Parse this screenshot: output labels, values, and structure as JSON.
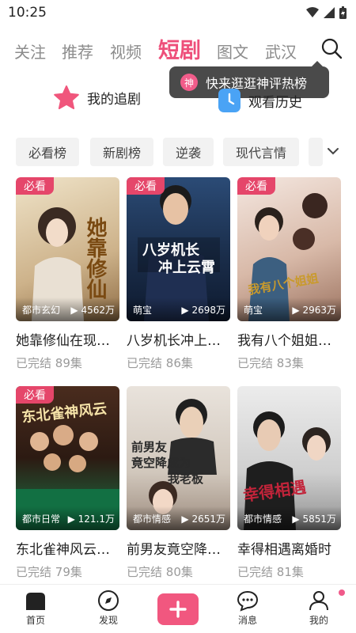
{
  "status": {
    "time": "10:25"
  },
  "nav": {
    "tabs": [
      "关注",
      "推荐",
      "视频",
      "短剧",
      "图文",
      "武汉"
    ],
    "active": "短剧"
  },
  "tooltip": {
    "badge": "神",
    "text": "快来逛逛神评热榜"
  },
  "quick": {
    "follow": "我的追剧",
    "history": "观看历史"
  },
  "chips": [
    "必看榜",
    "新剧榜",
    "逆袭",
    "现代言情"
  ],
  "cards": [
    {
      "badge": "必看",
      "genre": "都市玄幻",
      "views": "▶ 4562万",
      "title": "她靠修仙在现…",
      "status": "已完结",
      "episodes": "89集",
      "poster_text": "她靠修仙"
    },
    {
      "badge": "必看",
      "genre": "萌宝",
      "views": "▶ 2698万",
      "title": "八岁机长冲上…",
      "status": "已完结",
      "episodes": "86集",
      "poster_text": "八岁机长冲上云霄"
    },
    {
      "badge": "必看",
      "genre": "萌宝",
      "views": "▶ 2963万",
      "title": "我有八个姐姐…",
      "status": "已完结",
      "episodes": "83集",
      "poster_text": "我有八个姐姐"
    },
    {
      "badge": "必看",
      "genre": "都市日常",
      "views": "▶ 121.1万",
      "title": "东北雀神风云…",
      "status": "已完结",
      "episodes": "79集",
      "poster_text": "东北雀神风云"
    },
    {
      "badge": "",
      "genre": "都市情感",
      "views": "▶ 2651万",
      "title": "前男友竟空降…",
      "status": "已完结",
      "episodes": "80集",
      "poster_text": "前男友竟空降成为我老板"
    },
    {
      "badge": "",
      "genre": "都市情感",
      "views": "▶ 5851万",
      "title": "幸得相遇离婚时",
      "status": "已完结",
      "episodes": "81集",
      "poster_text": "幸得相遇"
    }
  ],
  "bottom": {
    "home": "首页",
    "discover": "发现",
    "messages": "消息",
    "mine": "我的"
  },
  "colors": {
    "accent": "#ee4f7a",
    "badge": "#e5466a"
  }
}
